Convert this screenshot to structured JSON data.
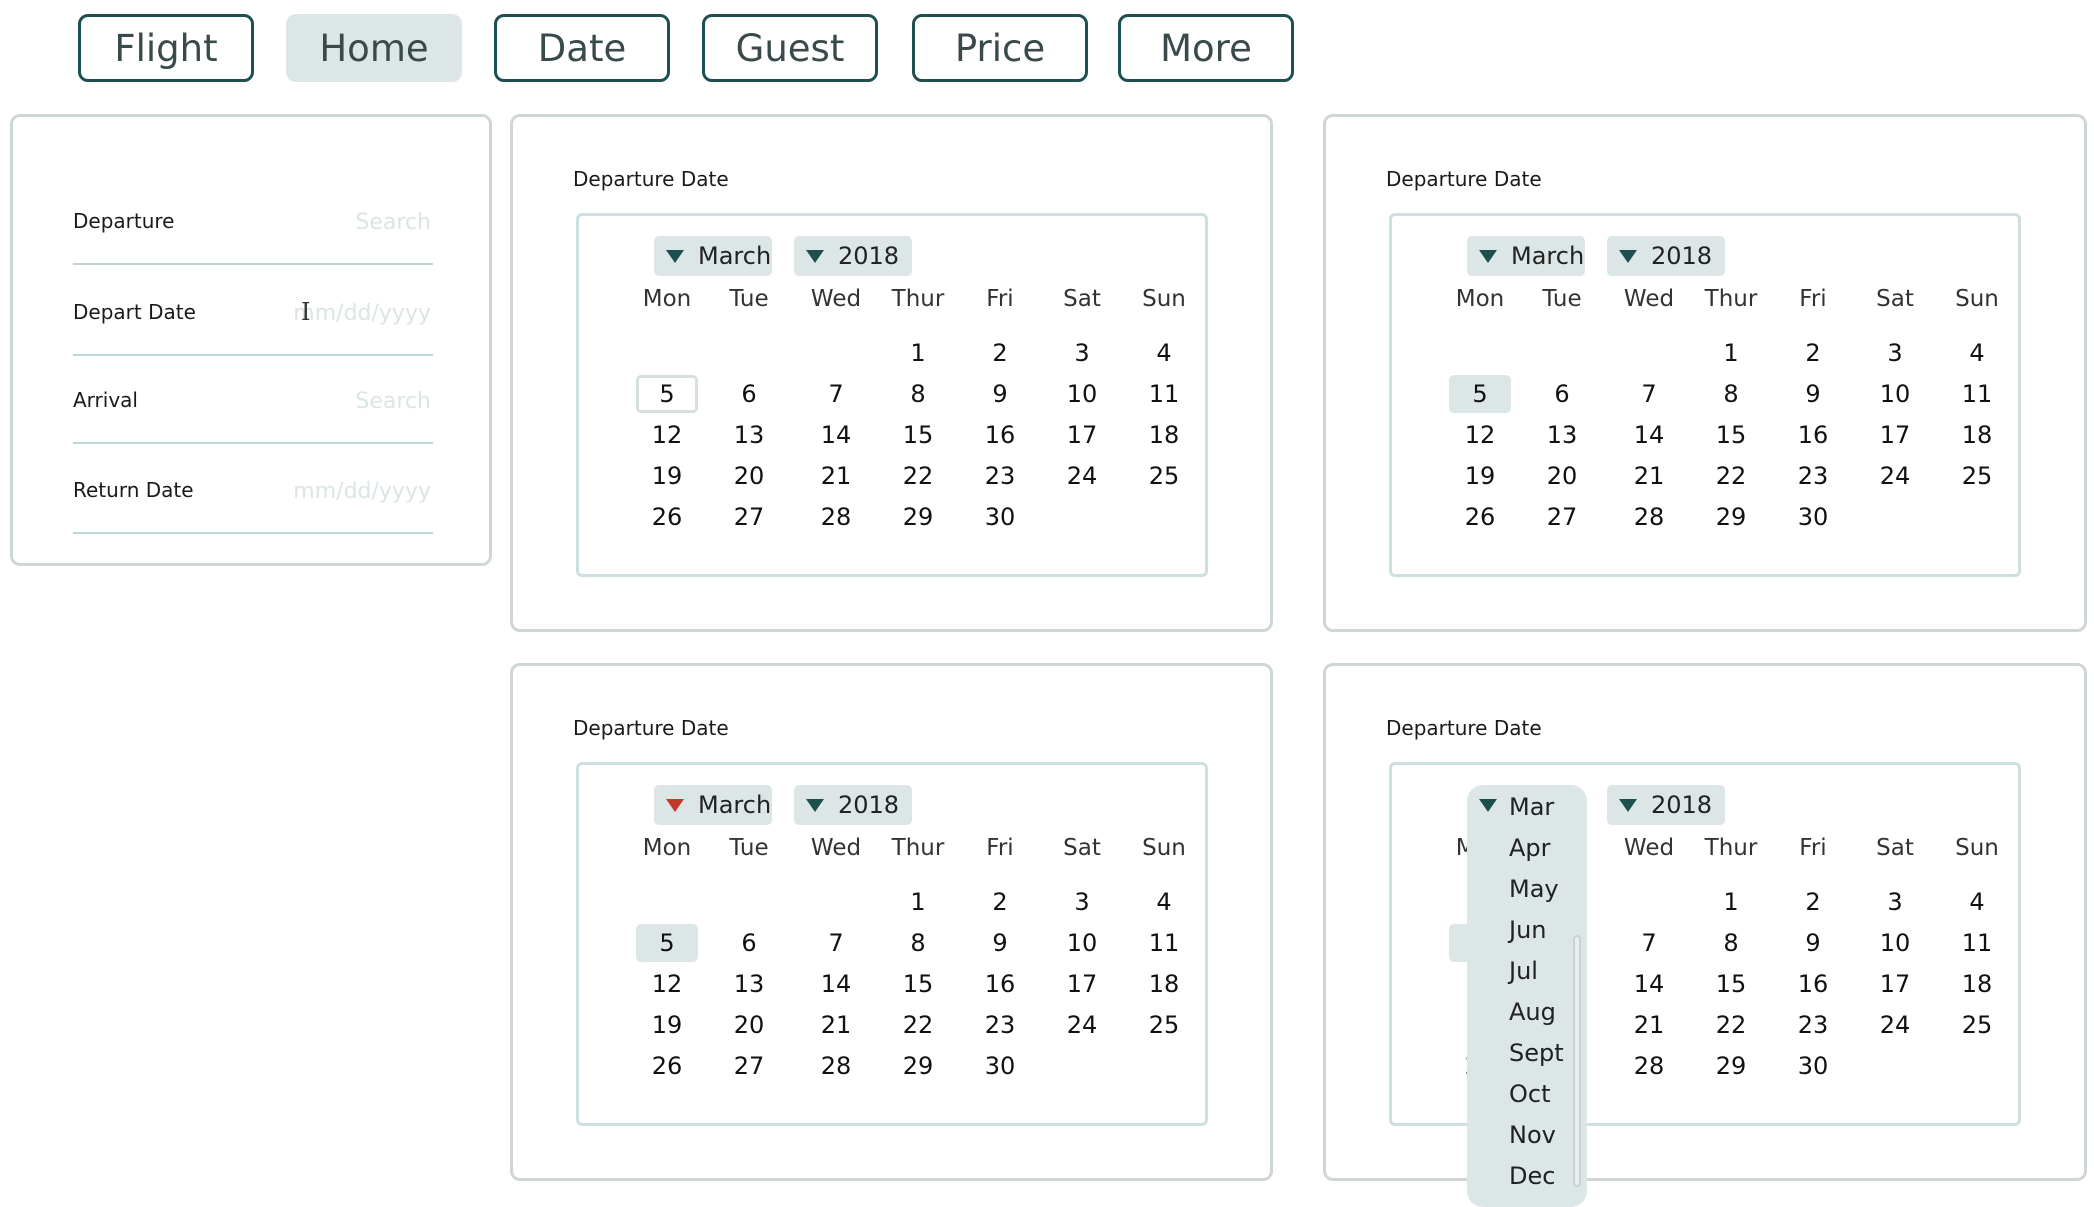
{
  "tabs": [
    {
      "label": "Flight",
      "active": false
    },
    {
      "label": "Home",
      "active": true
    },
    {
      "label": "Date",
      "active": false
    },
    {
      "label": "Guest",
      "active": false
    },
    {
      "label": "Price",
      "active": false
    },
    {
      "label": "More",
      "active": false
    }
  ],
  "form": {
    "rows": [
      {
        "label": "Departure",
        "placeholder": "Search"
      },
      {
        "label": "Depart Date",
        "placeholder": "mm/dd/yyyy"
      },
      {
        "label": "Arrival",
        "placeholder": "Search"
      },
      {
        "label": "Return Date",
        "placeholder": "mm/dd/yyyy"
      }
    ]
  },
  "calendar": {
    "title": "Departure Date",
    "month": "March",
    "year": "2018",
    "weekdays": [
      "Mon",
      "Tue",
      "Wed",
      "Thur",
      "Fri",
      "Sat",
      "Sun"
    ],
    "days": [
      "1",
      "2",
      "3",
      "4",
      "5",
      "6",
      "7",
      "8",
      "9",
      "10",
      "11",
      "12",
      "13",
      "14",
      "15",
      "16",
      "17",
      "18",
      "19",
      "20",
      "21",
      "22",
      "23",
      "24",
      "25",
      "26",
      "27",
      "28",
      "29",
      "30"
    ],
    "selected_day": "5"
  },
  "month_dropdown": {
    "options": [
      "Mar",
      "Apr",
      "May",
      "Jun",
      "Jul",
      "Aug",
      "Sept",
      "Oct",
      "Nov",
      "Dec"
    ],
    "selected": "Mar"
  },
  "colors": {
    "accent": "#1d4f4f",
    "highlight": "#dde6e6",
    "border": "#cfd6d6",
    "dropdown_arrow_active": "#c0392b"
  }
}
